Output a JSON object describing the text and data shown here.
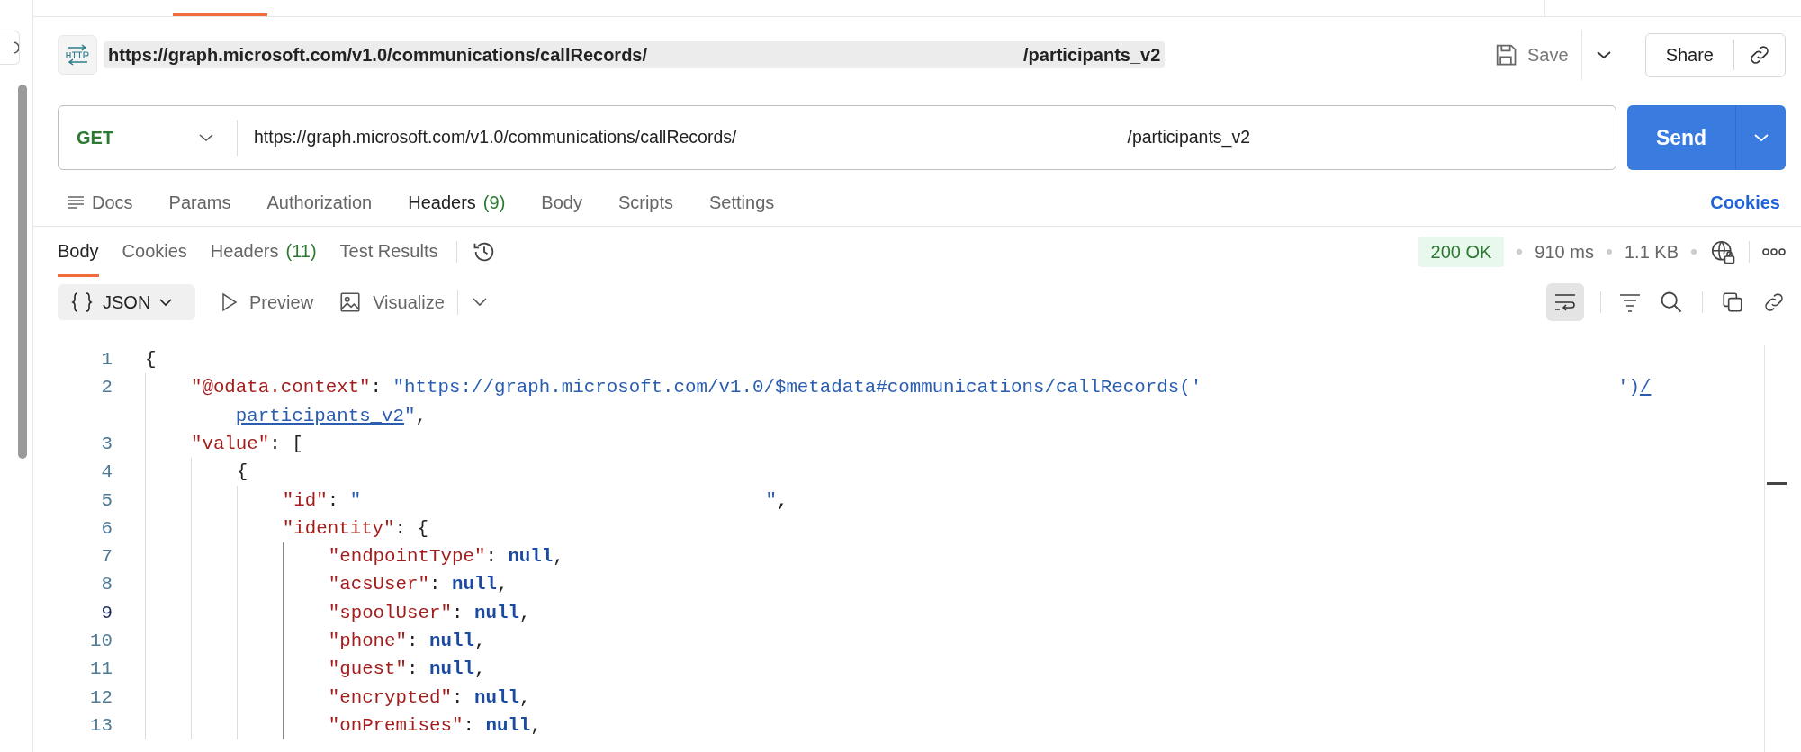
{
  "title_bar": {
    "title_parts": [
      "https://graph.microsoft.com/v1.0/communications/callRecords/",
      "/participants_v2"
    ],
    "save": "Save",
    "share": "Share"
  },
  "request": {
    "method": "GET",
    "url_parts": [
      "https://graph.microsoft.com/v1.0/communications/callRecords/",
      "/participants_v2"
    ],
    "send": "Send"
  },
  "request_tabs": [
    {
      "kind": "docs",
      "label": "Docs",
      "selected": false
    },
    {
      "kind": "plain",
      "label": "Params",
      "selected": false
    },
    {
      "kind": "plain",
      "label": "Authorization",
      "selected": false
    },
    {
      "kind": "plain",
      "label": "Headers",
      "count": "(9)",
      "selected": true
    },
    {
      "kind": "plain",
      "label": "Body",
      "selected": false
    },
    {
      "kind": "plain",
      "label": "Scripts",
      "selected": false
    },
    {
      "kind": "plain",
      "label": "Settings",
      "selected": false
    }
  ],
  "cookies_link": "Cookies",
  "response_tabs": [
    {
      "label": "Body",
      "selected": true
    },
    {
      "label": "Cookies",
      "selected": false
    },
    {
      "label": "Headers",
      "count": "(11)",
      "selected": false
    },
    {
      "label": "Test Results",
      "selected": false
    }
  ],
  "status": {
    "code": "200 OK",
    "time": "910 ms",
    "size": "1.1 KB"
  },
  "view": {
    "format": "JSON",
    "options": [
      "Preview",
      "Visualize"
    ],
    "wrap_on": true
  },
  "code": {
    "rows": [
      {
        "kind": "line",
        "number": "1",
        "current": false,
        "indent": "",
        "tokens": [
          {
            "kind": "punct",
            "text": "{"
          }
        ]
      },
      {
        "kind": "line",
        "number": "2",
        "current": false,
        "indent": "    ",
        "tokens": [
          {
            "kind": "key",
            "text": "\"@odata.context\""
          },
          {
            "kind": "punct",
            "text": ": "
          },
          {
            "kind": "string",
            "text": "\"https://graph.microsoft.com/v1.0/$metadata#communications/callRecords('                                     ')"
          },
          {
            "kind": "link",
            "text": "/"
          }
        ]
      },
      {
        "kind": "wrap",
        "indent": "        ",
        "tokens": [
          {
            "kind": "link",
            "text": "participants_v2"
          },
          {
            "kind": "string",
            "text": "\""
          },
          {
            "kind": "punct",
            "text": ","
          }
        ]
      },
      {
        "kind": "line",
        "number": "3",
        "current": false,
        "indent": "    ",
        "tokens": [
          {
            "kind": "key",
            "text": "\"value\""
          },
          {
            "kind": "punct",
            "text": ": ["
          }
        ]
      },
      {
        "kind": "line",
        "number": "4",
        "current": false,
        "indent": "        ",
        "tokens": [
          {
            "kind": "punct",
            "text": "{"
          }
        ]
      },
      {
        "kind": "line",
        "number": "5",
        "current": false,
        "indent": "            ",
        "tokens": [
          {
            "kind": "key",
            "text": "\"id\""
          },
          {
            "kind": "punct",
            "text": ": "
          },
          {
            "kind": "string",
            "text": "\"                                    \""
          },
          {
            "kind": "punct",
            "text": ","
          }
        ]
      },
      {
        "kind": "line",
        "number": "6",
        "current": false,
        "indent": "            ",
        "tokens": [
          {
            "kind": "key",
            "text": "\"identity\""
          },
          {
            "kind": "punct",
            "text": ": {"
          }
        ]
      },
      {
        "kind": "line",
        "number": "7",
        "current": false,
        "indent": "                ",
        "tokens": [
          {
            "kind": "key",
            "text": "\"endpointType\""
          },
          {
            "kind": "punct",
            "text": ": "
          },
          {
            "kind": "null",
            "text": "null"
          },
          {
            "kind": "punct",
            "text": ","
          }
        ]
      },
      {
        "kind": "line",
        "number": "8",
        "current": false,
        "indent": "                ",
        "tokens": [
          {
            "kind": "key",
            "text": "\"acsUser\""
          },
          {
            "kind": "punct",
            "text": ": "
          },
          {
            "kind": "null",
            "text": "null"
          },
          {
            "kind": "punct",
            "text": ","
          }
        ]
      },
      {
        "kind": "line",
        "number": "9",
        "current": true,
        "indent": "                ",
        "tokens": [
          {
            "kind": "key",
            "text": "\"spoolUser\""
          },
          {
            "kind": "punct",
            "text": ": "
          },
          {
            "kind": "null",
            "text": "null"
          },
          {
            "kind": "punct",
            "text": ","
          }
        ]
      },
      {
        "kind": "line",
        "number": "10",
        "current": false,
        "indent": "                ",
        "tokens": [
          {
            "kind": "key",
            "text": "\"phone\""
          },
          {
            "kind": "punct",
            "text": ": "
          },
          {
            "kind": "null",
            "text": "null"
          },
          {
            "kind": "punct",
            "text": ","
          }
        ]
      },
      {
        "kind": "line",
        "number": "11",
        "current": false,
        "indent": "                ",
        "tokens": [
          {
            "kind": "key",
            "text": "\"guest\""
          },
          {
            "kind": "punct",
            "text": ": "
          },
          {
            "kind": "null",
            "text": "null"
          },
          {
            "kind": "punct",
            "text": ","
          }
        ]
      },
      {
        "kind": "line",
        "number": "12",
        "current": false,
        "indent": "                ",
        "tokens": [
          {
            "kind": "key",
            "text": "\"encrypted\""
          },
          {
            "kind": "punct",
            "text": ": "
          },
          {
            "kind": "null",
            "text": "null"
          },
          {
            "kind": "punct",
            "text": ","
          }
        ]
      },
      {
        "kind": "line",
        "number": "13",
        "current": false,
        "indent": "                ",
        "tokens": [
          {
            "kind": "key",
            "text": "\"onPremises\""
          },
          {
            "kind": "punct",
            "text": ": "
          },
          {
            "kind": "null",
            "text": "null"
          },
          {
            "kind": "punct",
            "text": ","
          }
        ]
      }
    ]
  }
}
